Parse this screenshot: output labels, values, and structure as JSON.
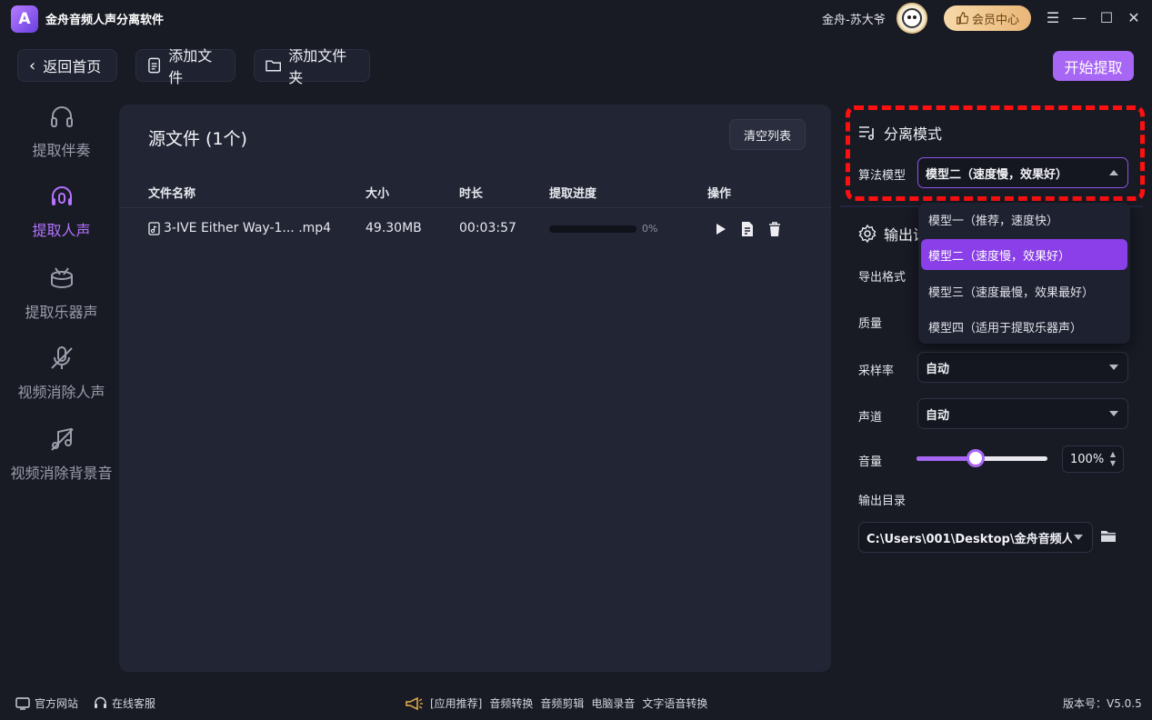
{
  "app": {
    "title": "金舟音频人声分离软件",
    "logo_letter": "A"
  },
  "user": {
    "name": "金舟-苏大爷",
    "vip_label": "会员中心"
  },
  "toolbar": {
    "back": "返回首页",
    "add_file": "添加文件",
    "add_folder": "添加文件夹",
    "start": "开始提取"
  },
  "sidebar": {
    "items": [
      {
        "label": "提取伴奏",
        "icon": "headphones-icon"
      },
      {
        "label": "提取人声",
        "icon": "headset-mic-icon",
        "active": true
      },
      {
        "label": "提取乐器声",
        "icon": "drum-icon"
      },
      {
        "label": "视频消除人声",
        "icon": "mic-off-icon"
      },
      {
        "label": "视频消除背景音",
        "icon": "music-off-icon"
      }
    ]
  },
  "main": {
    "title": "源文件 (1个)",
    "clear_button": "清空列表",
    "columns": [
      "文件名称",
      "大小",
      "时长",
      "提取进度",
      "操作"
    ],
    "rows": [
      {
        "name": "3-IVE Either Way-1... .mp4",
        "size": "49.30MB",
        "duration": "00:03:57",
        "progress": 0,
        "progress_label": "0%"
      }
    ]
  },
  "settings": {
    "mode_title": "分离模式",
    "algo_label": "算法模型",
    "algo_value": "模型二（速度慢，效果好）",
    "algo_options": [
      "模型一（推荐，速度快）",
      "模型二（速度慢，效果好）",
      "模型三（速度最慢，效果最好）",
      "模型四（适用于提取乐器声）"
    ],
    "algo_selected_index": 1,
    "output_title": "输出设",
    "format_label": "导出格式",
    "quality_label": "质量",
    "samplerate_label": "采样率",
    "samplerate_value": "自动",
    "channel_label": "声道",
    "channel_value": "自动",
    "volume_label": "音量",
    "volume_value": "100%",
    "volume_level": 0.45,
    "outdir_label": "输出目录",
    "outdir_value": "C:\\Users\\001\\Desktop\\金舟音频人"
  },
  "footer": {
    "official_site": "官方网站",
    "support": "在线客服",
    "recommend": "[应用推荐]",
    "links": [
      "音频转换",
      "音频剪辑",
      "电脑录音",
      "文字语音转换"
    ],
    "version": "版本号：V5.0.5"
  },
  "colors": {
    "accent": "#a766f4",
    "selected": "#8a3fe8",
    "highlight": "#ff1010",
    "background": "#181a24"
  }
}
